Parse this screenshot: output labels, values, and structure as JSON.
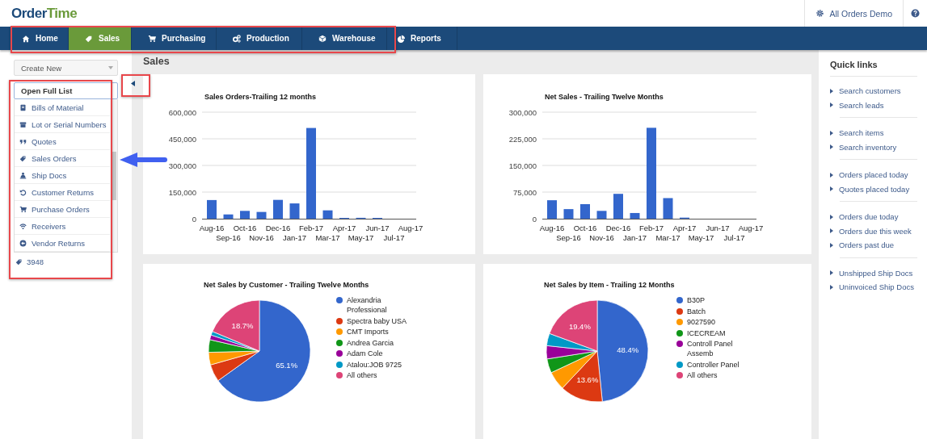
{
  "header": {
    "logo": [
      "Order",
      "Time"
    ],
    "account": "All Orders Demo"
  },
  "nav": [
    {
      "label": "Home",
      "selected": false
    },
    {
      "label": "Sales",
      "selected": true
    },
    {
      "label": "Purchasing",
      "selected": false
    },
    {
      "label": "Production",
      "selected": false
    },
    {
      "label": "Warehouse",
      "selected": false
    },
    {
      "label": "Reports",
      "selected": false
    }
  ],
  "sidebar": {
    "create_new": "Create New",
    "list_dropdown": "Open Full List",
    "list_items": [
      {
        "label": "Bills of Material"
      },
      {
        "label": "Lot or Serial Numbers"
      },
      {
        "label": "Quotes"
      },
      {
        "label": "Sales Orders"
      },
      {
        "label": "Ship Docs"
      },
      {
        "label": "Customer Returns"
      },
      {
        "label": "Purchase Orders"
      },
      {
        "label": "Receivers"
      },
      {
        "label": "Vendor Returns"
      }
    ],
    "recent": {
      "label": "3948"
    }
  },
  "page_title": "Sales",
  "charts": [
    {
      "chart_data": {
        "type": "bar",
        "title": "Sales Orders-Trailing 12 months",
        "categories": [
          "Aug-16",
          "Sep-16",
          "Oct-16",
          "Nov-16",
          "Dec-16",
          "Jan-17",
          "Feb-17",
          "Mar-17",
          "Apr-17",
          "May-17",
          "Jun-17",
          "Jul-17",
          "Aug-17"
        ],
        "values": [
          105000,
          24000,
          44000,
          38000,
          106000,
          86000,
          511000,
          47000,
          4500,
          5000,
          4500,
          0,
          0
        ],
        "ylim": [
          0,
          600000
        ],
        "grid": true,
        "yticks": [
          {
            "value": 0,
            "label": "0"
          },
          {
            "value": 150000,
            "label": "150,000"
          },
          {
            "value": 300000,
            "label": "300,000"
          },
          {
            "value": 450000,
            "label": "450,000"
          },
          {
            "value": 600000,
            "label": "600,000"
          }
        ]
      }
    },
    {
      "chart_data": {
        "type": "bar",
        "title": "Net Sales - Trailing Twelve Months",
        "categories": [
          "Aug-16",
          "Sep-16",
          "Oct-16",
          "Nov-16",
          "Dec-16",
          "Jan-17",
          "Feb-17",
          "Mar-17",
          "Apr-17",
          "May-17",
          "Jun-17",
          "Jul-17",
          "Aug-17"
        ],
        "values": [
          52000,
          27000,
          41000,
          22000,
          70000,
          16000,
          256000,
          58000,
          3000,
          0,
          0,
          0,
          0
        ],
        "ylim": [
          0,
          300000
        ],
        "grid": true,
        "yticks": [
          {
            "value": 0,
            "label": "0"
          },
          {
            "value": 75000,
            "label": "75,000"
          },
          {
            "value": 150000,
            "label": "150,000"
          },
          {
            "value": 225000,
            "label": "225,000"
          },
          {
            "value": 300000,
            "label": "300,000"
          }
        ]
      }
    },
    {
      "chart_data": {
        "type": "pie",
        "title": "Net Sales by Customer - Trailing Twelve Months",
        "categories": [
          "Alexandria Professional",
          "Spectra baby USA",
          "CMT Imports",
          "Andrea Garcia",
          "Adam Cole",
          "Atalou:JOB 9725",
          "All others"
        ],
        "values": [
          65.1,
          5.5,
          4.0,
          4.0,
          1.5,
          1.2,
          18.7
        ],
        "legend": "right",
        "value_labels": [
          "65.1%",
          null,
          null,
          null,
          null,
          null,
          "18.7%"
        ]
      }
    },
    {
      "chart_data": {
        "type": "pie",
        "title": "Net Sales by Item - Trailing 12 Months",
        "categories": [
          "B30P",
          "Batch",
          "9027590",
          "ICECREAM",
          "Controll Panel Assemb",
          "Controller Panel",
          "All others"
        ],
        "values": [
          48.4,
          13.6,
          6.0,
          4.5,
          4.2,
          3.9,
          19.4
        ],
        "legend": "right",
        "value_labels": [
          "48.4%",
          "13.6%",
          null,
          null,
          null,
          null,
          "19.4%"
        ]
      }
    }
  ],
  "quick_links": {
    "title": "Quick links",
    "groups": [
      [
        "Search customers",
        "Search leads"
      ],
      [
        "Search items",
        "Search inventory"
      ],
      [
        "Orders placed today",
        "Quotes placed today"
      ],
      [
        "Orders due today",
        "Orders due this week",
        "Orders past due"
      ],
      [
        "Unshipped Ship Docs",
        "Uninvoiced Ship Docs"
      ]
    ]
  }
}
